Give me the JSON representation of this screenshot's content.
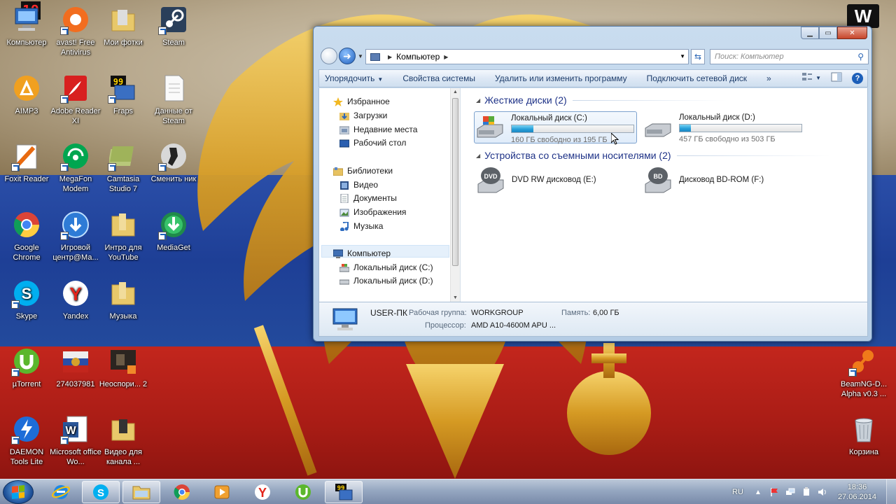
{
  "overlay": {
    "fps": "19",
    "watermark": "W"
  },
  "desktop": {
    "icons": [
      {
        "id": "computer",
        "label": "Компьютер"
      },
      {
        "id": "avast",
        "label": "avast! Free Antivirus"
      },
      {
        "id": "my-photos",
        "label": "Мои фотки"
      },
      {
        "id": "steam",
        "label": "Steam"
      },
      {
        "id": "aimp3",
        "label": "AIMP3"
      },
      {
        "id": "adobe-reader",
        "label": "Adobe Reader XI"
      },
      {
        "id": "fraps",
        "label": "Fraps"
      },
      {
        "id": "steam-data",
        "label": "Данные от Steam"
      },
      {
        "id": "foxit",
        "label": "Foxit Reader"
      },
      {
        "id": "megafon",
        "label": "MegaFon Modem"
      },
      {
        "id": "camtasia",
        "label": "Camtasia Studio 7"
      },
      {
        "id": "change-nick",
        "label": "Сменить ник"
      },
      {
        "id": "chrome",
        "label": "Google Chrome"
      },
      {
        "id": "game-center",
        "label": "Игровой центр@Ма..."
      },
      {
        "id": "intro-youtube",
        "label": "Интро для YouTube"
      },
      {
        "id": "mediaget",
        "label": "MediaGet"
      },
      {
        "id": "skype",
        "label": "Skype"
      },
      {
        "id": "yandex",
        "label": "Yandex"
      },
      {
        "id": "music-folder",
        "label": "Музыка"
      },
      {
        "id": "utorrent",
        "label": "µTorrent"
      },
      {
        "id": "num-274037981",
        "label": "274037981"
      },
      {
        "id": "neospori",
        "label": "Неоспори... 2"
      },
      {
        "id": "daemon-tools",
        "label": "DAEMON Tools Lite"
      },
      {
        "id": "word",
        "label": "Microsoft office Wo..."
      },
      {
        "id": "video-channel",
        "label": "Видео для канала ..."
      },
      {
        "id": "beamng",
        "label": "BeamNG-D... Alpha v0.3 ..."
      },
      {
        "id": "recycle-bin",
        "label": "Корзина"
      }
    ]
  },
  "window": {
    "address": {
      "location": "Компьютер"
    },
    "search": {
      "placeholder": "Поиск: Компьютер"
    },
    "toolbar": {
      "organize": "Упорядочить",
      "system_properties": "Свойства системы",
      "uninstall": "Удалить или изменить программу",
      "map_drive": "Подключить сетевой диск",
      "more": "»"
    },
    "nav": {
      "favorites": "Избранное",
      "downloads": "Загрузки",
      "recent": "Недавние места",
      "desktop": "Рабочий стол",
      "libraries": "Библиотеки",
      "video": "Видео",
      "documents": "Документы",
      "images": "Изображения",
      "music": "Музыка",
      "computer": "Компьютер",
      "disk_c": "Локальный диск (C:)",
      "disk_d": "Локальный диск (D:)"
    },
    "groups": {
      "hard_disks": "Жесткие диски (2)",
      "removable": "Устройства со съемными носителями (2)"
    },
    "drives": [
      {
        "name": "Локальный диск (C:)",
        "free": "160 ГБ свободно из 195 ГБ",
        "used_fraction": 0.18
      },
      {
        "name": "Локальный диск (D:)",
        "free": "457 ГБ свободно из 503 ГБ",
        "used_fraction": 0.09
      }
    ],
    "removable": [
      {
        "name": "DVD RW дисковод (E:)",
        "badge": "DVD"
      },
      {
        "name": "Дисковод BD-ROM (F:)",
        "badge": "BD"
      }
    ],
    "details": {
      "pc_name": "USER-ПК",
      "workgroup_label": "Рабочая группа:",
      "workgroup": "WORKGROUP",
      "memory_label": "Память:",
      "memory": "6,00 ГБ",
      "cpu_label": "Процессор:",
      "cpu": "AMD A10-4600M APU ..."
    }
  },
  "taskbar": {
    "lang": "RU",
    "time": "18:36",
    "date": "27.06.2014",
    "pinned": [
      "internet-explorer",
      "skype",
      "explorer",
      "chrome",
      "media-player",
      "yandex",
      "utorrent",
      "fraps"
    ]
  }
}
